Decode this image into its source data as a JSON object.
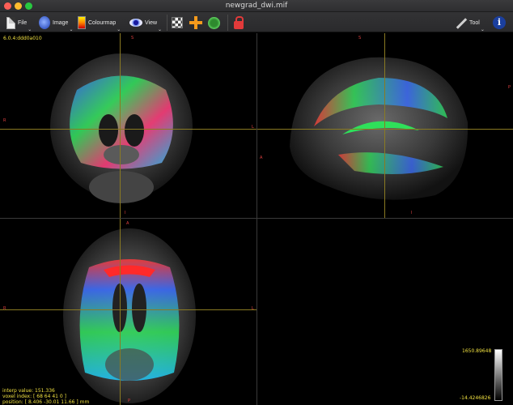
{
  "window": {
    "title": "newgrad_dwi.mif"
  },
  "toolbar": {
    "file_label": "File",
    "image_label": "Image",
    "colourmap_label": "Colourmap",
    "view_label": "View",
    "tool_label": "Tool",
    "dropdown_glyph": "⌄",
    "info_glyph": "i"
  },
  "version": "6.0.4:ddd0a010",
  "coronal": {
    "top": "S",
    "bottom": "I",
    "left": "R",
    "right": "L"
  },
  "sagittal": {
    "top": "S",
    "bottom": "I",
    "left": "A",
    "right": "P"
  },
  "axial": {
    "top": "A",
    "bottom": "P",
    "left": "R",
    "right": "L"
  },
  "status": {
    "interp_value": "interp value: 151.336",
    "voxel_index": "voxel index: [ 68 64 41 0 ]",
    "position": "position: [ 8.406 -30.01 11.66 ] mm"
  },
  "colorbar": {
    "max": "1650.89648",
    "min": "-14.4246826"
  }
}
